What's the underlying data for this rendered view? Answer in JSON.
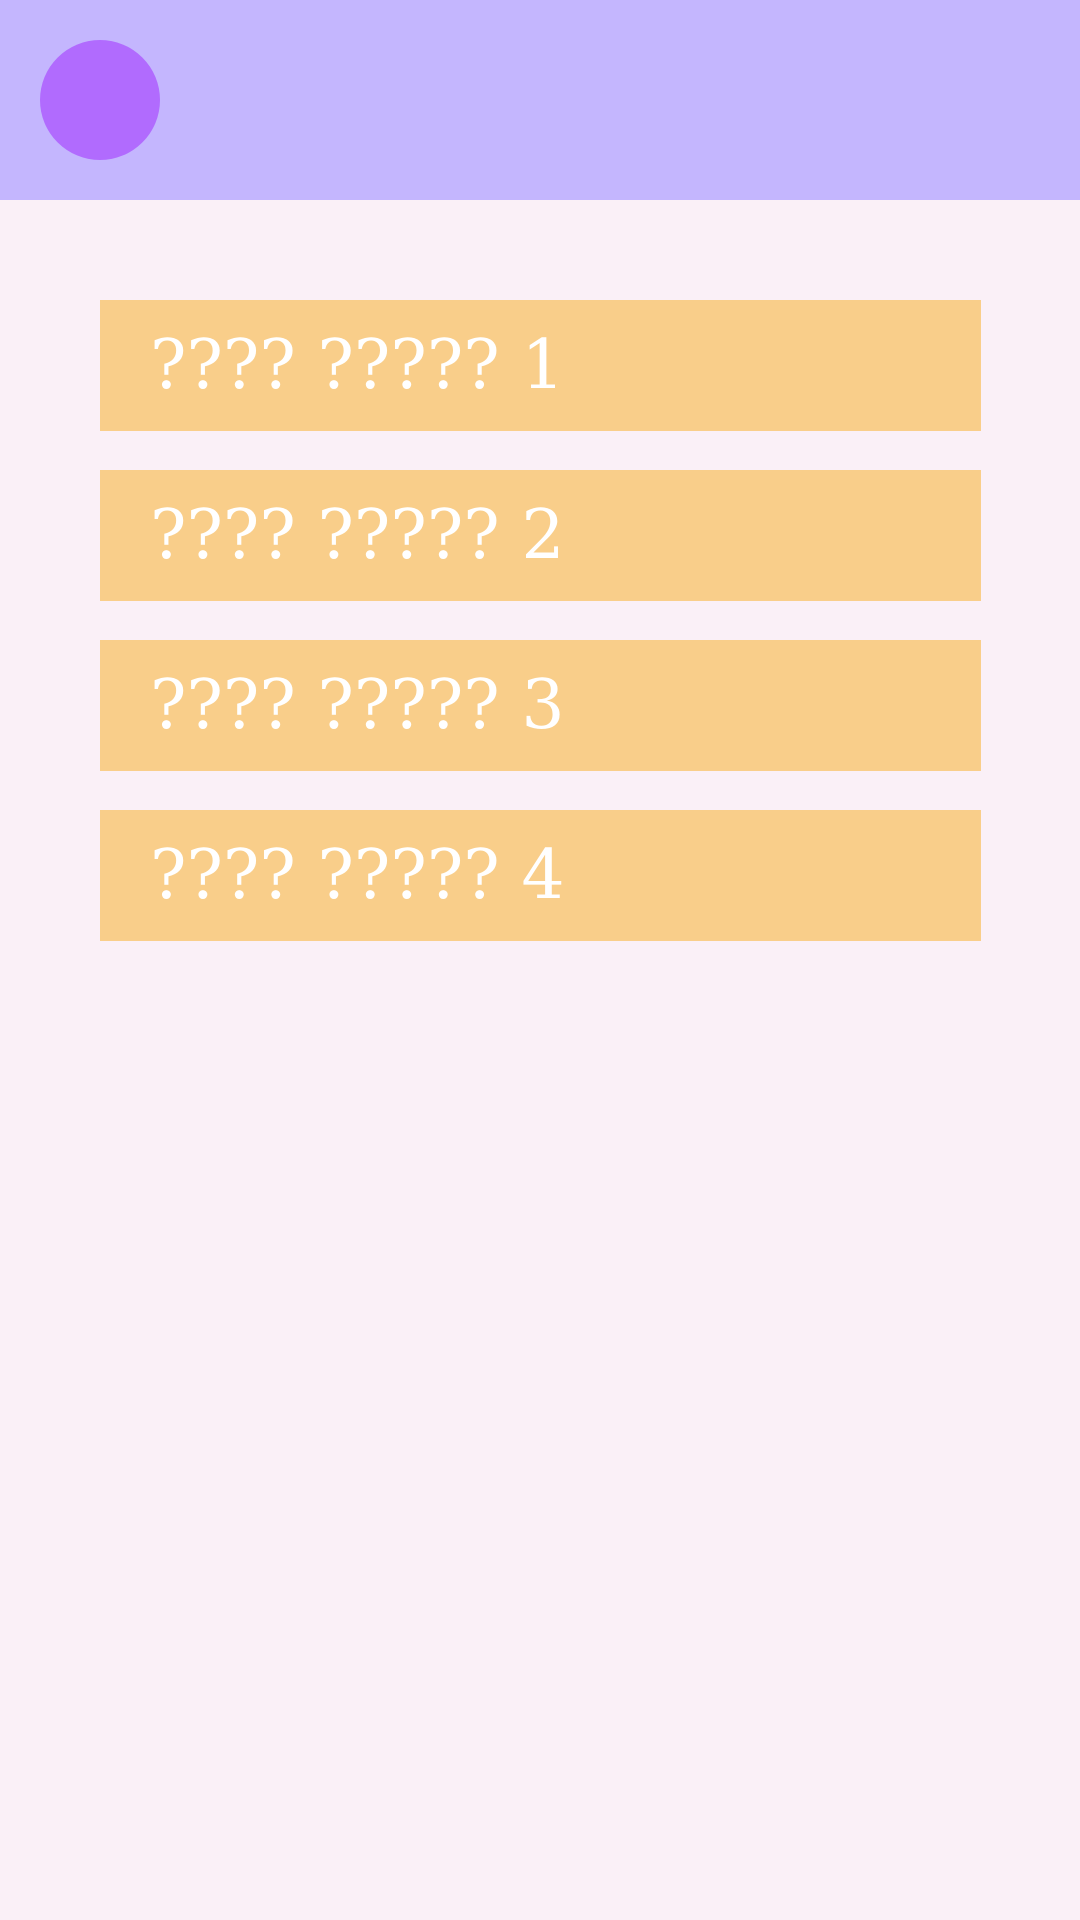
{
  "header": {
    "avatar_icon": "avatar-circle",
    "background_color": "#C4B6FE",
    "avatar_color": "#B16BFE"
  },
  "menu": {
    "item_color": "#F9CE8A",
    "items": [
      {
        "label": "???? ????? 1"
      },
      {
        "label": "???? ????? 2"
      },
      {
        "label": "???? ????? 3"
      },
      {
        "label": "???? ????? 4"
      }
    ]
  },
  "page": {
    "background_color": "#FAF0F7"
  }
}
